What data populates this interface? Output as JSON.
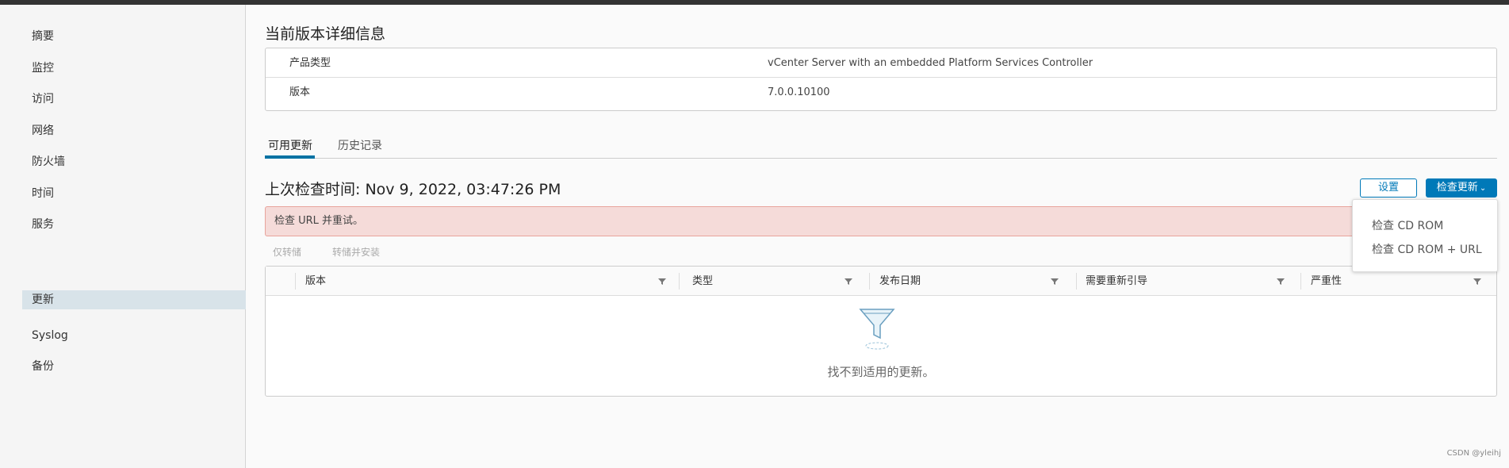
{
  "sidebar": {
    "items": [
      {
        "label": "摘要"
      },
      {
        "label": "监控"
      },
      {
        "label": "访问"
      },
      {
        "label": "网络"
      },
      {
        "label": "防火墙"
      },
      {
        "label": "时间"
      },
      {
        "label": "服务"
      },
      {
        "label": "更新"
      },
      {
        "label": "Syslog"
      },
      {
        "label": "备份"
      }
    ],
    "active": "更新"
  },
  "version_details": {
    "title": "当前版本详细信息",
    "rows": [
      {
        "key": "产品类型",
        "value": "vCenter Server with an embedded Platform Services Controller"
      },
      {
        "key": "版本",
        "value": "7.0.0.10100"
      }
    ]
  },
  "tabs": [
    {
      "label": "可用更新"
    },
    {
      "label": "历史记录"
    }
  ],
  "updates": {
    "last_check": "上次检查时间: Nov 9, 2022, 03:47:26 PM",
    "settings_label": "设置",
    "check_updates_label": "检查更新",
    "dropdown": [
      {
        "label": "检查 CD ROM"
      },
      {
        "label": "检查 CD ROM + URL"
      }
    ],
    "alert": "检查 URL 并重试。",
    "actions": {
      "stage_only": "仅转储",
      "stage_install": "转储并安装"
    },
    "columns": [
      {
        "label": "版本"
      },
      {
        "label": "类型"
      },
      {
        "label": "发布日期"
      },
      {
        "label": "需要重新引导"
      },
      {
        "label": "严重性"
      }
    ],
    "empty_text": "找不到适用的更新。"
  },
  "watermark": "CSDN @yleihj",
  "colors": {
    "primary": "#0079b8",
    "alert_bg": "#f5dbd9",
    "active_nav": "#d8e3e9"
  }
}
